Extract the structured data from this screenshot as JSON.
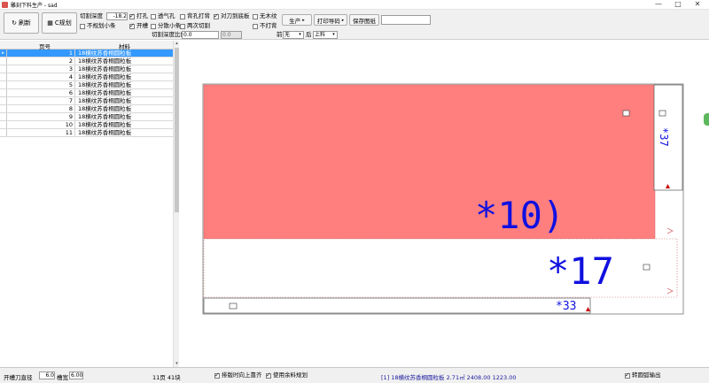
{
  "window": {
    "title": "雕刻下料生产 - sad",
    "minimize": "—",
    "maximize": "□",
    "close": "✕"
  },
  "toolbar": {
    "refresh_label": "刷新",
    "plan_label": "C规划",
    "cut_depth_label": "切割深度",
    "cut_depth_value": "-18.2",
    "drill_hole": "打孔",
    "vent_hole": "透气孔",
    "back_drill": "背孔打背",
    "to_blade_bottom": "对刀到底板",
    "no_wood_grain": "无木纹",
    "not_plan_small": "不规划小条",
    "open_groove": "开槽",
    "split_small": "分散小条",
    "cut_twice": "两次切割",
    "not_flip": "不打背",
    "cut_depth_ratio_label": "切割深度比例",
    "ratio_value1": "0.0",
    "ratio_value2": "0.0",
    "front_label": "前",
    "front_value": "无",
    "back_label": "后",
    "back_value": "上料",
    "produce_label": "生产",
    "print_label": "打印导码",
    "save_drawing_label": "保存图纸",
    "save_input_value": ""
  },
  "grid": {
    "col_no": "页号",
    "col_material": "材料",
    "rows": [
      {
        "no": "1",
        "mat": "18横纹苏香桐圆粒板"
      },
      {
        "no": "2",
        "mat": "18横纹苏香桐圆粒板"
      },
      {
        "no": "3",
        "mat": "18横纹苏香桐圆粒板"
      },
      {
        "no": "4",
        "mat": "18横纹苏香桐圆粒板"
      },
      {
        "no": "5",
        "mat": "18横纹苏香桐圆粒板"
      },
      {
        "no": "6",
        "mat": "18横纹苏香桐圆粒板"
      },
      {
        "no": "7",
        "mat": "18横纹苏香桐圆粒板"
      },
      {
        "no": "8",
        "mat": "18横纹苏香桐圆粒板"
      },
      {
        "no": "9",
        "mat": "18横纹苏香桐圆粒板"
      },
      {
        "no": "10",
        "mat": "18横纹苏香桐圆粒板"
      },
      {
        "no": "11",
        "mat": "18横纹苏香桐圆粒板"
      }
    ]
  },
  "canvas": {
    "panel_a": "*10)",
    "panel_b": "*17",
    "panel_c": "*37",
    "panel_d": "*33",
    "pink": "#ff7f7f",
    "label_color": "#1010e0"
  },
  "status": {
    "groove_dia_label": "开槽刀直径",
    "groove_dia_value": "6.0",
    "groove_width_label": "槽宽",
    "groove_width_value": "6.00",
    "pages_info": "11页 41块",
    "align_top": "排版时向上靠齐",
    "use_leftover": "使用余料规划",
    "sheet_info": "[1] 18横纹苏香桐圆粒板 2.71㎡ 2408.00 1223.00",
    "arc_output": "转圆弧输出"
  }
}
